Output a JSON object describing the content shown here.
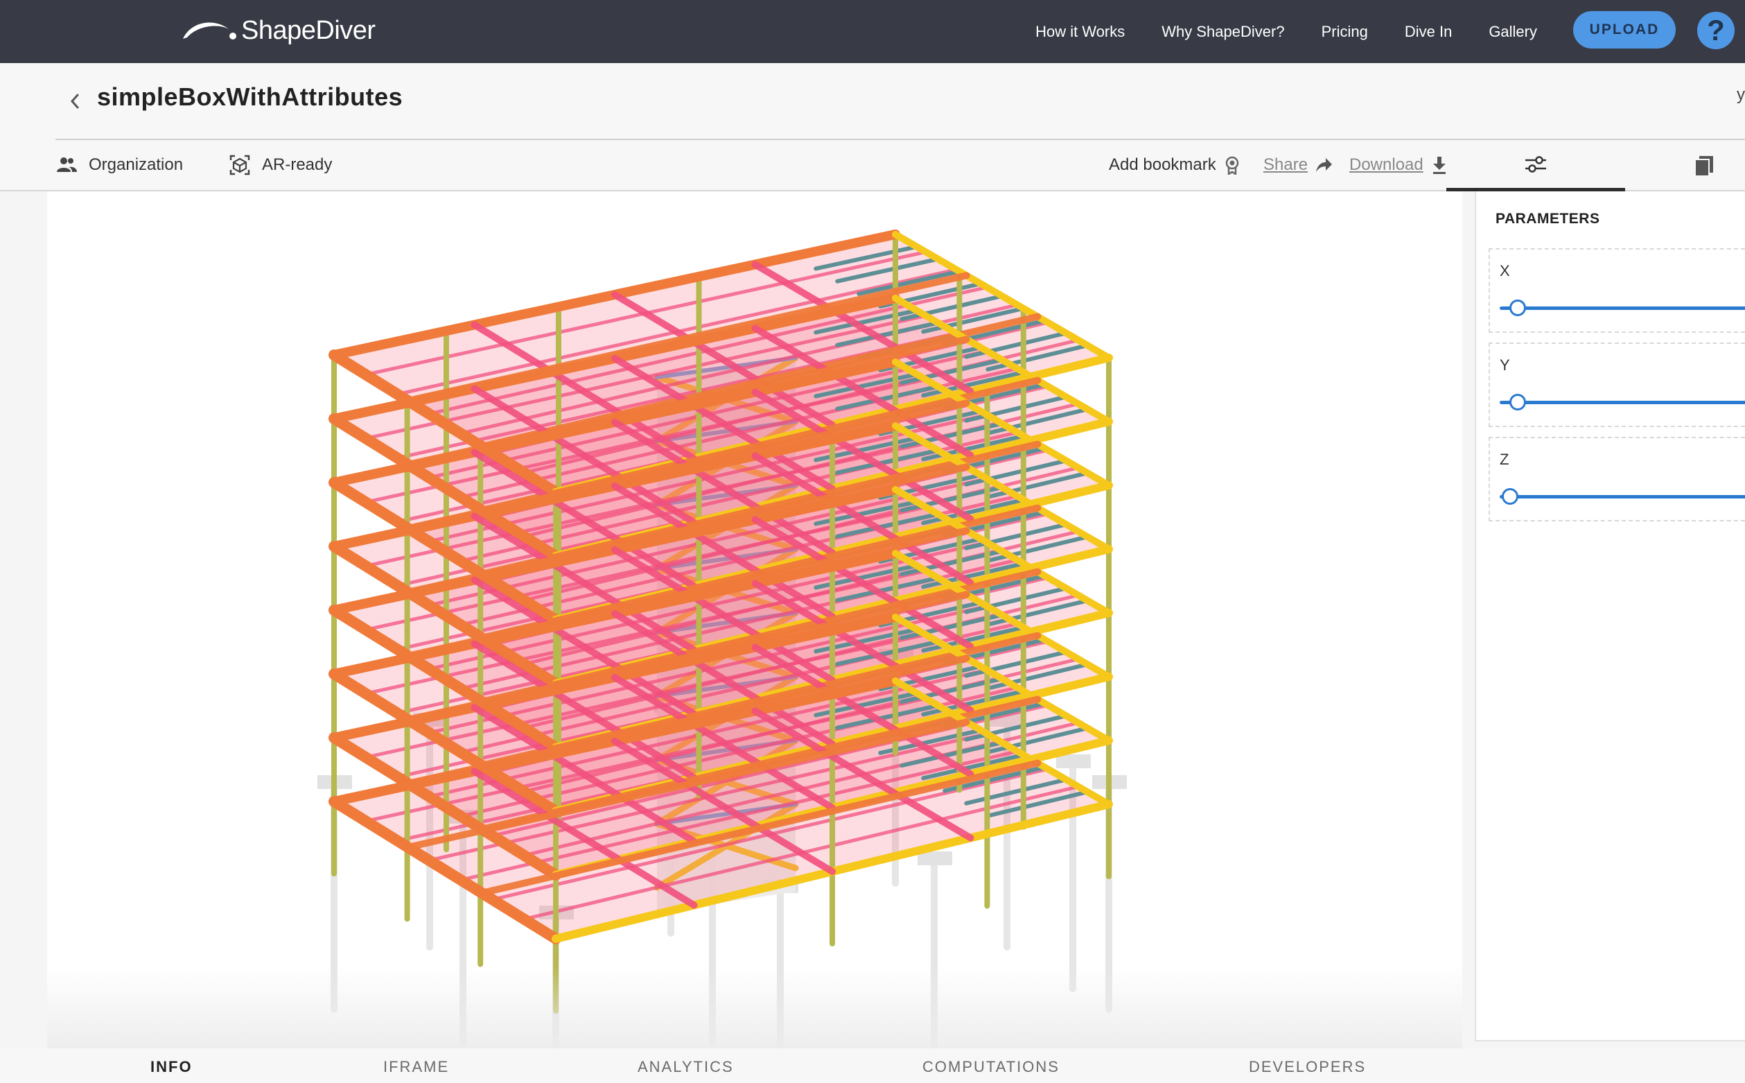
{
  "nav": {
    "brand": "ShapeDiver",
    "links": [
      "How it Works",
      "Why ShapeDiver?",
      "Pricing",
      "Dive In",
      "Gallery"
    ],
    "upload_label": "UPLOAD",
    "help_label": "?"
  },
  "header": {
    "title": "simpleBoxWithAttributes",
    "edge_text": "y"
  },
  "actions": {
    "organization": "Organization",
    "ar_ready": "AR-ready",
    "add_bookmark": "Add bookmark",
    "share": "Share",
    "download": "Download"
  },
  "panel": {
    "title": "PARAMETERS",
    "params": [
      {
        "label": "X",
        "value_fraction": 0.07
      },
      {
        "label": "Y",
        "value_fraction": 0.07
      },
      {
        "label": "Z",
        "value_fraction": 0.04
      }
    ]
  },
  "bottom_tabs": [
    "INFO",
    "IFRAME",
    "ANALYTICS",
    "COMPUTATIONS",
    "DEVELOPERS"
  ],
  "active_bottom_tab": "INFO",
  "colors": {
    "nav_bg": "#383b45",
    "accent": "#4f98e6",
    "slider": "#2a7ad0",
    "beam_orange": "#f07a3a",
    "beam_pink": "#f2507e",
    "beam_yellow": "#f6c81c",
    "beam_teal": "#5f8f96",
    "column": "#b8b850"
  },
  "icons": {
    "back": "chevron-left-icon",
    "organization": "people-icon",
    "ar": "ar-cube-icon",
    "bookmark": "bookmark-badge-icon",
    "share": "share-arrow-icon",
    "download": "download-icon",
    "parameters_tab": "sliders-icon",
    "docs_tab": "documents-icon"
  }
}
